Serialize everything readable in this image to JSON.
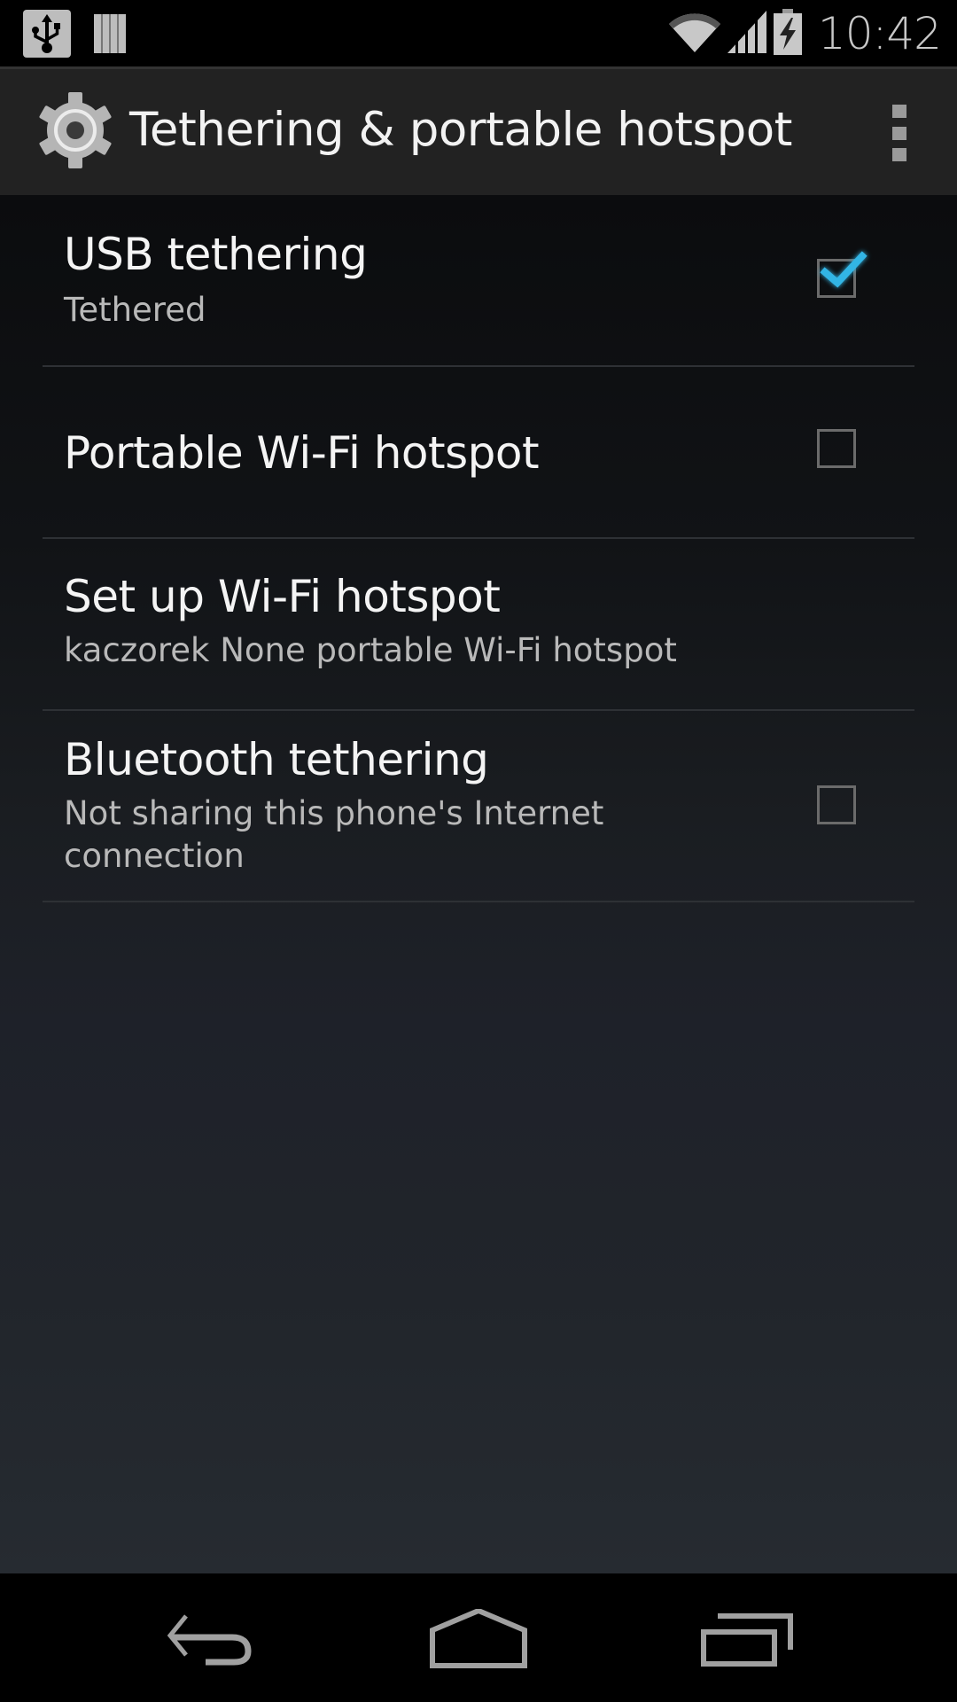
{
  "status_bar": {
    "notifications": [
      {
        "icon": "usb-icon",
        "meaning": "USB connected"
      },
      {
        "icon": "sd-card-icon",
        "meaning": "storage notification"
      }
    ],
    "indicators": [
      "wifi-signal-icon",
      "cell-signal-icon",
      "battery-charging-icon"
    ],
    "time": "10:42"
  },
  "action_bar": {
    "icon": "settings-gear-icon",
    "title": "Tethering & portable hotspot",
    "overflow_icon": "overflow-menu-icon"
  },
  "preferences": [
    {
      "title": "USB tethering",
      "summary": "Tethered",
      "has_checkbox": true,
      "checked": true
    },
    {
      "title": "Portable Wi-Fi hotspot",
      "summary": "",
      "has_checkbox": true,
      "checked": false
    },
    {
      "title": "Set up Wi-Fi hotspot",
      "summary": "kaczorek None portable Wi-Fi hotspot",
      "has_checkbox": false
    },
    {
      "title": "Bluetooth tethering",
      "summary": "Not sharing this phone's Internet connection",
      "has_checkbox": true,
      "checked": false
    }
  ],
  "nav_bar": {
    "buttons": [
      "back-icon",
      "home-icon",
      "recent-apps-icon"
    ]
  },
  "colors": {
    "accent_check": "#33b5e5",
    "action_bar_bg": "#222222",
    "title_text": "#f4f4f4",
    "summary_text": "#b9b9b9"
  }
}
